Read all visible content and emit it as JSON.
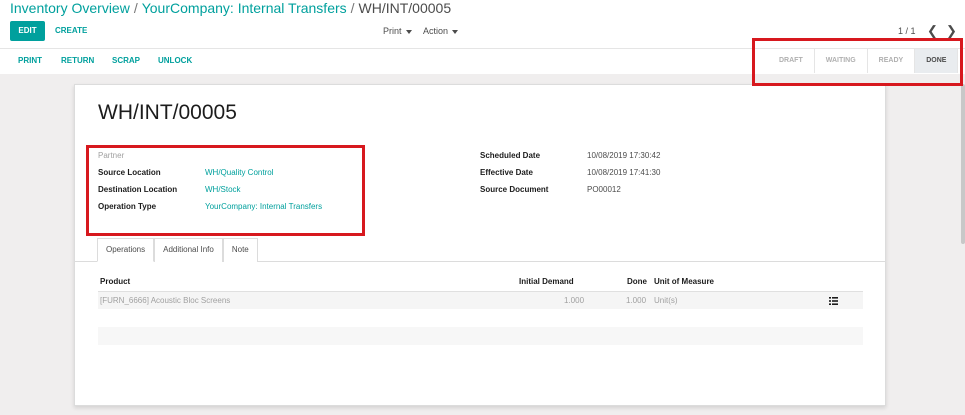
{
  "breadcrumb": [
    "Inventory Overview",
    "YourCompany: Internal Transfers",
    "WH/INT/00005"
  ],
  "toolbar": {
    "edit": "EDIT",
    "create": "CREATE",
    "print": "Print",
    "action": "Action",
    "pager": "1 / 1",
    "prev": "❮",
    "next": "❯"
  },
  "statusbar": {
    "actions": [
      "PRINT",
      "RETURN",
      "SCRAP",
      "UNLOCK"
    ],
    "stages": [
      "DRAFT",
      "WAITING",
      "READY",
      "DONE"
    ]
  },
  "record": {
    "title": "WH/INT/00005",
    "left_fields": [
      {
        "label": "Partner",
        "value": ""
      },
      {
        "label": "Source Location",
        "value": "WH/Quality Control"
      },
      {
        "label": "Destination Location",
        "value": "WH/Stock"
      },
      {
        "label": "Operation Type",
        "value": "YourCompany: Internal Transfers"
      }
    ],
    "right_fields": [
      {
        "label": "Scheduled Date",
        "value": "10/08/2019 17:30:42"
      },
      {
        "label": "Effective Date",
        "value": "10/08/2019 17:41:30"
      },
      {
        "label": "Source Document",
        "value": "PO00012"
      }
    ]
  },
  "tabs": [
    "Operations",
    "Additional Info",
    "Note"
  ],
  "table": {
    "headers": [
      "Product",
      "Initial Demand",
      "Done",
      "Unit of Measure"
    ],
    "rows": [
      {
        "product": "[FURN_6666] Acoustic Bloc Screens",
        "initial_demand": "1.000",
        "done": "1.000",
        "uom": "Unit(s)"
      }
    ]
  },
  "colors": {
    "accent": "#00a09d",
    "highlight": "#d7181e"
  }
}
